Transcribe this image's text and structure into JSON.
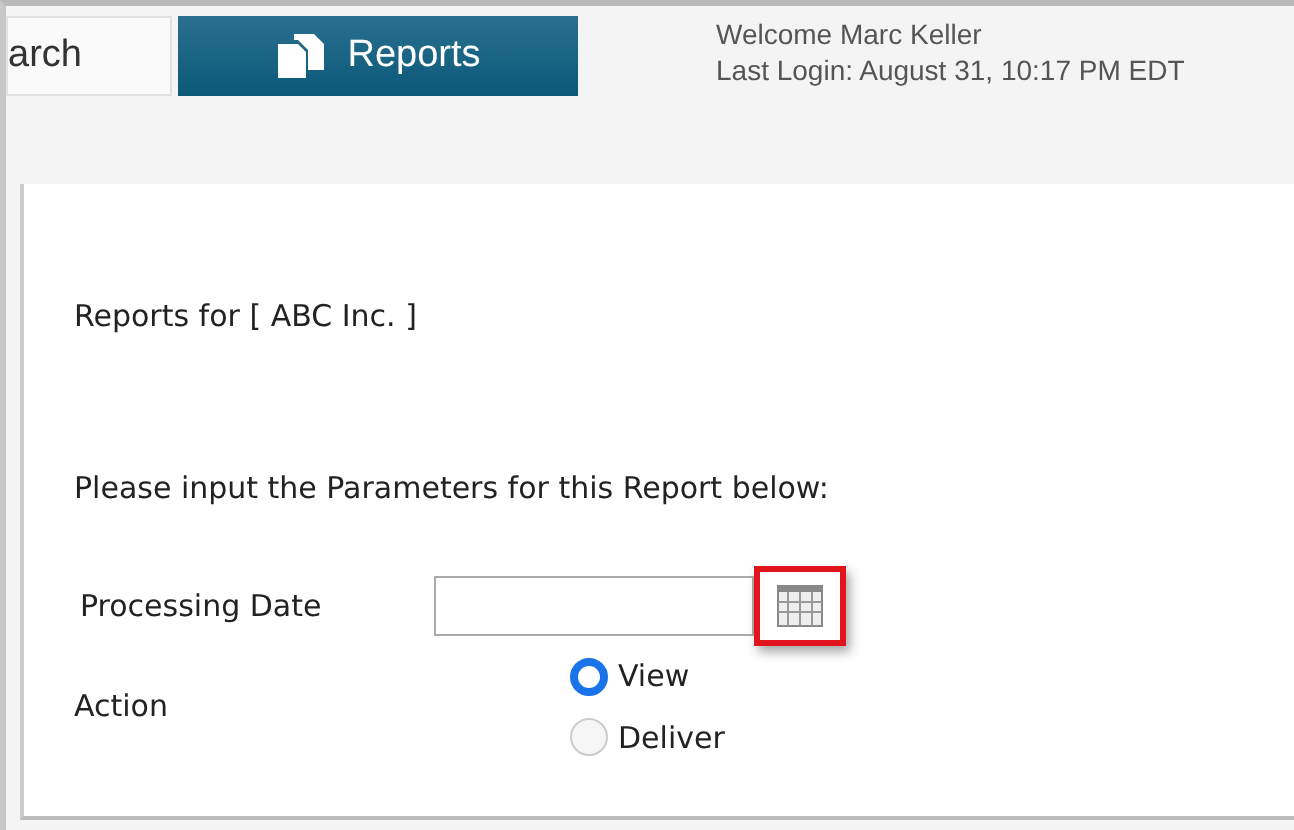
{
  "tabs": [
    {
      "label": "arch",
      "selected": false
    },
    {
      "label": "Reports",
      "selected": true
    }
  ],
  "welcome": {
    "greeting": "Welcome Marc Keller",
    "last_login": "Last Login: August 31, 10:17 PM EDT"
  },
  "heading": "Reports for [ ABC Inc. ]",
  "instruction": "Please input the Parameters for this Report below:",
  "processing_date": {
    "label": "Processing Date",
    "calendar_highlighted": true
  },
  "action": {
    "label": "Action",
    "options": [
      {
        "label": "View",
        "selected": true
      },
      {
        "label": "Deliver",
        "selected": false
      }
    ]
  }
}
